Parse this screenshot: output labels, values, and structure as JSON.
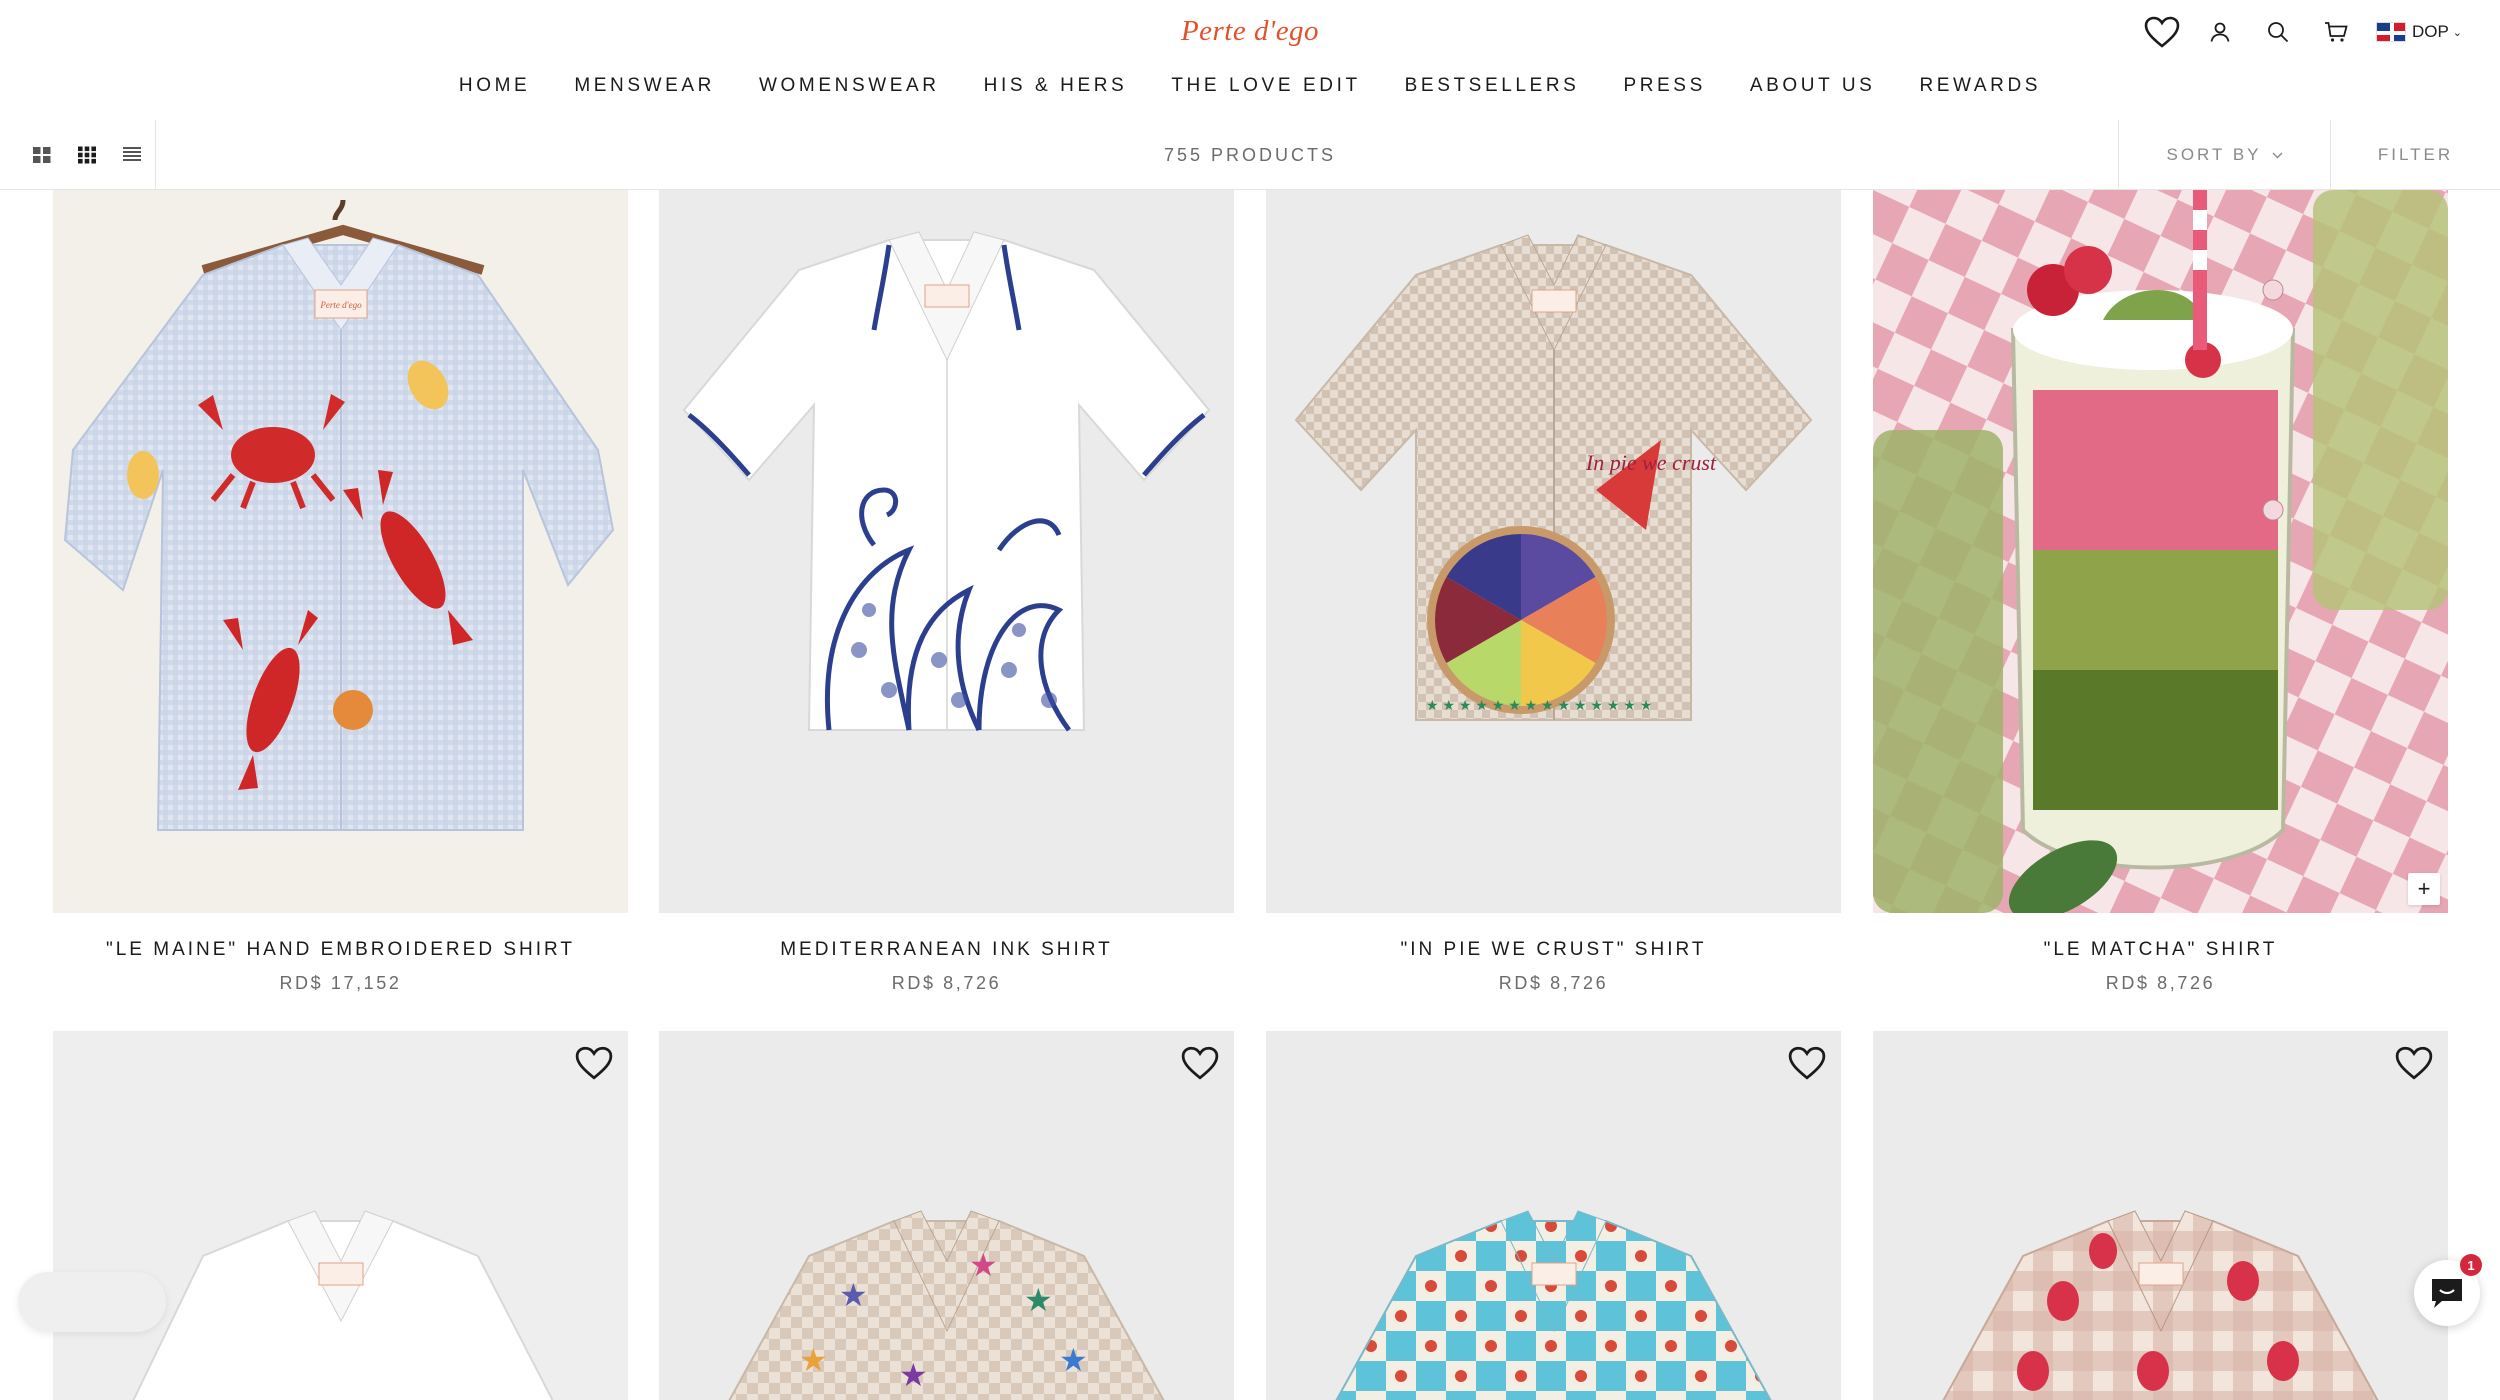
{
  "brand": {
    "logo_text": "Perte d'ego",
    "accent": "#e0522c"
  },
  "header": {
    "icons": [
      "heart-icon",
      "account-icon",
      "search-icon",
      "cart-icon"
    ],
    "currency": {
      "code": "DOP",
      "flag": "dominican-republic-flag"
    }
  },
  "nav": {
    "items": [
      "HOME",
      "MENSWEAR",
      "WOMENSWEAR",
      "HIS & HERS",
      "THE LOVE EDIT",
      "BESTSELLERS",
      "PRESS",
      "ABOUT US",
      "REWARDS"
    ]
  },
  "toolbar": {
    "product_count": "755 PRODUCTS",
    "sort_label": "SORT BY",
    "filter_label": "FILTER",
    "view_modes": [
      "grid-large-icon",
      "grid-small-icon",
      "list-icon"
    ]
  },
  "products": [
    {
      "title": "\"LE MAINE\" HAND EMBROIDERED SHIRT",
      "price": "RD$ 17,152"
    },
    {
      "title": "MEDITERRANEAN INK SHIRT",
      "price": "RD$ 8,726"
    },
    {
      "title": "\"IN PIE WE CRUST\" SHIRT",
      "price": "RD$ 8,726"
    },
    {
      "title": "\"LE MATCHA\" SHIRT",
      "price": "RD$ 8,726"
    },
    {
      "title": "",
      "price": ""
    },
    {
      "title": "",
      "price": ""
    },
    {
      "title": "",
      "price": ""
    },
    {
      "title": "",
      "price": ""
    }
  ],
  "shirt_labels": {
    "pie_text": "In pie we crust",
    "tag": "Perte d'ego"
  },
  "chat": {
    "badge_count": "1"
  }
}
